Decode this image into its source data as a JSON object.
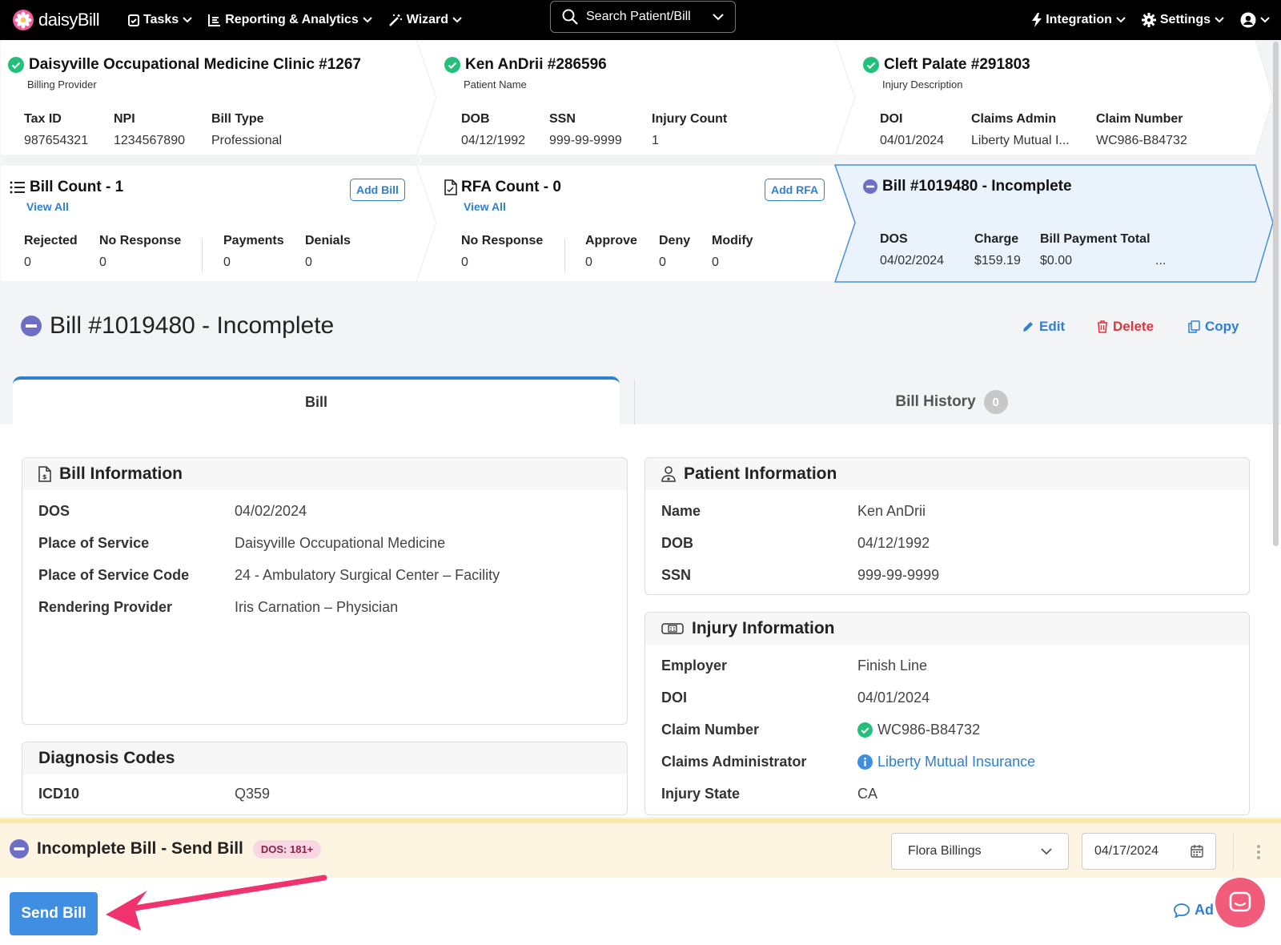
{
  "nav": {
    "logo": "daisyBill",
    "items": [
      {
        "label": "Tasks"
      },
      {
        "label": "Reporting & Analytics"
      },
      {
        "label": "Wizard"
      }
    ],
    "search_label": "Search Patient/Bill",
    "right": [
      {
        "label": "Integration"
      },
      {
        "label": "Settings"
      }
    ]
  },
  "billing_provider": {
    "title": "Daisyville Occupational Medicine Clinic #1267",
    "subtitle": "Billing Provider",
    "fields": [
      {
        "label": "Tax ID",
        "value": "987654321"
      },
      {
        "label": "NPI",
        "value": "1234567890"
      },
      {
        "label": "Bill Type",
        "value": "Professional"
      }
    ]
  },
  "patient_card": {
    "title": "Ken AnDrii #286596",
    "subtitle": "Patient Name",
    "fields": [
      {
        "label": "DOB",
        "value": "04/12/1992"
      },
      {
        "label": "SSN",
        "value": "999-99-9999"
      },
      {
        "label": "Injury Count",
        "value": "1"
      }
    ]
  },
  "injury_card": {
    "title": "Cleft Palate #291803",
    "subtitle": "Injury Description",
    "fields": [
      {
        "label": "DOI",
        "value": "04/01/2024"
      },
      {
        "label": "Claims Admin",
        "value": "Liberty Mutual I..."
      },
      {
        "label": "Claim Number",
        "value": "WC986-B84732"
      }
    ]
  },
  "bill_count": {
    "title": "Bill Count - 1",
    "view_all": "View All",
    "button": "Add Bill",
    "fields": [
      {
        "label": "Rejected",
        "value": "0"
      },
      {
        "label": "No Response",
        "value": "0"
      },
      {
        "label": "Payments",
        "value": "0"
      },
      {
        "label": "Denials",
        "value": "0"
      }
    ]
  },
  "rfa_count": {
    "title": "RFA Count - 0",
    "view_all": "View All",
    "button": "Add RFA",
    "fields": [
      {
        "label": "No Response",
        "value": "0"
      },
      {
        "label": "Approve",
        "value": "0"
      },
      {
        "label": "Deny",
        "value": "0"
      },
      {
        "label": "Modify",
        "value": "0"
      }
    ]
  },
  "bill_card": {
    "title": "Bill #1019480 - Incomplete",
    "fields": [
      {
        "label": "DOS",
        "value": "04/02/2024"
      },
      {
        "label": "Charge",
        "value": "$159.19"
      },
      {
        "label": "Bill Payment Total",
        "value": "$0.00"
      }
    ],
    "ellipsis": "..."
  },
  "bill_header": {
    "title": "Bill #1019480 - Incomplete",
    "actions": {
      "edit": "Edit",
      "delete": "Delete",
      "copy": "Copy"
    }
  },
  "tabs": {
    "bill": "Bill",
    "history": "Bill History",
    "history_count": "0"
  },
  "bill_info": {
    "title": "Bill Information",
    "rows": [
      {
        "label": "DOS",
        "value": "04/02/2024"
      },
      {
        "label": "Place of Service",
        "value": "Daisyville Occupational Medicine"
      },
      {
        "label": "Place of Service Code",
        "value": "24 - Ambulatory Surgical Center – Facility"
      },
      {
        "label": "Rendering Provider",
        "value": "Iris Carnation – Physician"
      }
    ]
  },
  "patient_info": {
    "title": "Patient Information",
    "rows": [
      {
        "label": "Name",
        "value": "Ken AnDrii"
      },
      {
        "label": "DOB",
        "value": "04/12/1992"
      },
      {
        "label": "SSN",
        "value": "999-99-9999"
      }
    ]
  },
  "injury_info": {
    "title": "Injury Information",
    "rows": [
      {
        "label": "Employer",
        "value": "Finish Line"
      },
      {
        "label": "DOI",
        "value": "04/01/2024"
      },
      {
        "label": "Claim Number",
        "value": "WC986-B84732"
      },
      {
        "label": "Claims Administrator",
        "value": "Liberty Mutual Insurance"
      },
      {
        "label": "Injury State",
        "value": "CA"
      }
    ]
  },
  "diagnosis": {
    "title": "Diagnosis Codes",
    "rows": [
      {
        "label": "ICD10",
        "value": "Q359"
      }
    ]
  },
  "send_bar": {
    "title": "Incomplete Bill - Send Bill",
    "badge": "DOS: 181+",
    "assignee": "Flora Billings",
    "date": "04/17/2024",
    "send_button": "Send Bill",
    "add_link": "Ad"
  },
  "colors": {
    "accent": "#2f7fd6",
    "success": "#22c07a",
    "incomplete": "#6c6fc5",
    "danger": "#e0343f",
    "arrow": "#f0336f"
  }
}
